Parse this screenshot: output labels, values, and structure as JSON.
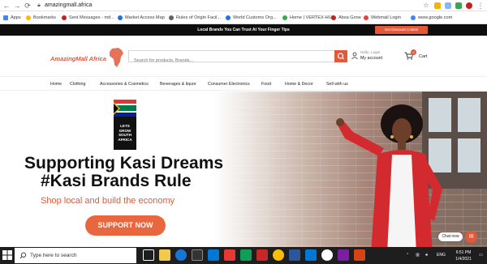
{
  "browser": {
    "url": "amazingmall.africa",
    "bookmarks": [
      {
        "label": "Apps",
        "color": "#4285f4"
      },
      {
        "label": "Bookmarks",
        "color": "#fbbc04"
      },
      {
        "label": "Sent Messages - md...",
        "color": "#c5221f"
      },
      {
        "label": "Market Access Map",
        "color": "#1a73e8"
      },
      {
        "label": "Rules of Origin Facil...",
        "color": "#5f6368"
      },
      {
        "label": "World Customs Org...",
        "color": "#1a73e8"
      },
      {
        "label": "Home | VERTEX-HUB",
        "color": "#34a853"
      },
      {
        "label": "Absa Grow",
        "color": "#c5221f"
      },
      {
        "label": "Webmail Login",
        "color": "#ea4335"
      },
      {
        "label": "www.google.com",
        "color": "#4285f4"
      }
    ]
  },
  "site": {
    "promo_text": "Local Brands You Can Trust At Your Finger Tips",
    "promo_button": "Get Discount Codes!",
    "logo_text": "AmazingMall Africa",
    "search_placeholder": "Search for products, Brands...",
    "hello_text": "Hello, Login",
    "account_label": "My account",
    "cart_count": "0",
    "cart_label": "Cart",
    "menu": [
      "Home",
      "Clothing",
      "Accessories & Cosmetics",
      "Beverages & liquor",
      "Consumer Electronics",
      "Food",
      "Home & Decor",
      "Sell with us"
    ],
    "hero": {
      "flag_text_1": "LETS",
      "flag_text_2": "GROW",
      "flag_text_3": "SOUTH",
      "flag_text_4": "AFRICA",
      "headline_1": "Supporting Kasi Dreams",
      "headline_2": "#Kasi Brands Rule",
      "subheadline": "Shop local and build the economy",
      "cta": "SUPPORT NOW"
    },
    "chat_label": "Chat now"
  },
  "taskbar": {
    "search_placeholder": "Type here to search",
    "clock_time": "6:51 PM",
    "clock_date": "1/4/2021"
  },
  "colors": {
    "accent": "#e2593a",
    "promo_bg": "#0d0d0d",
    "taskbar_bg": "#1e1e1e"
  }
}
